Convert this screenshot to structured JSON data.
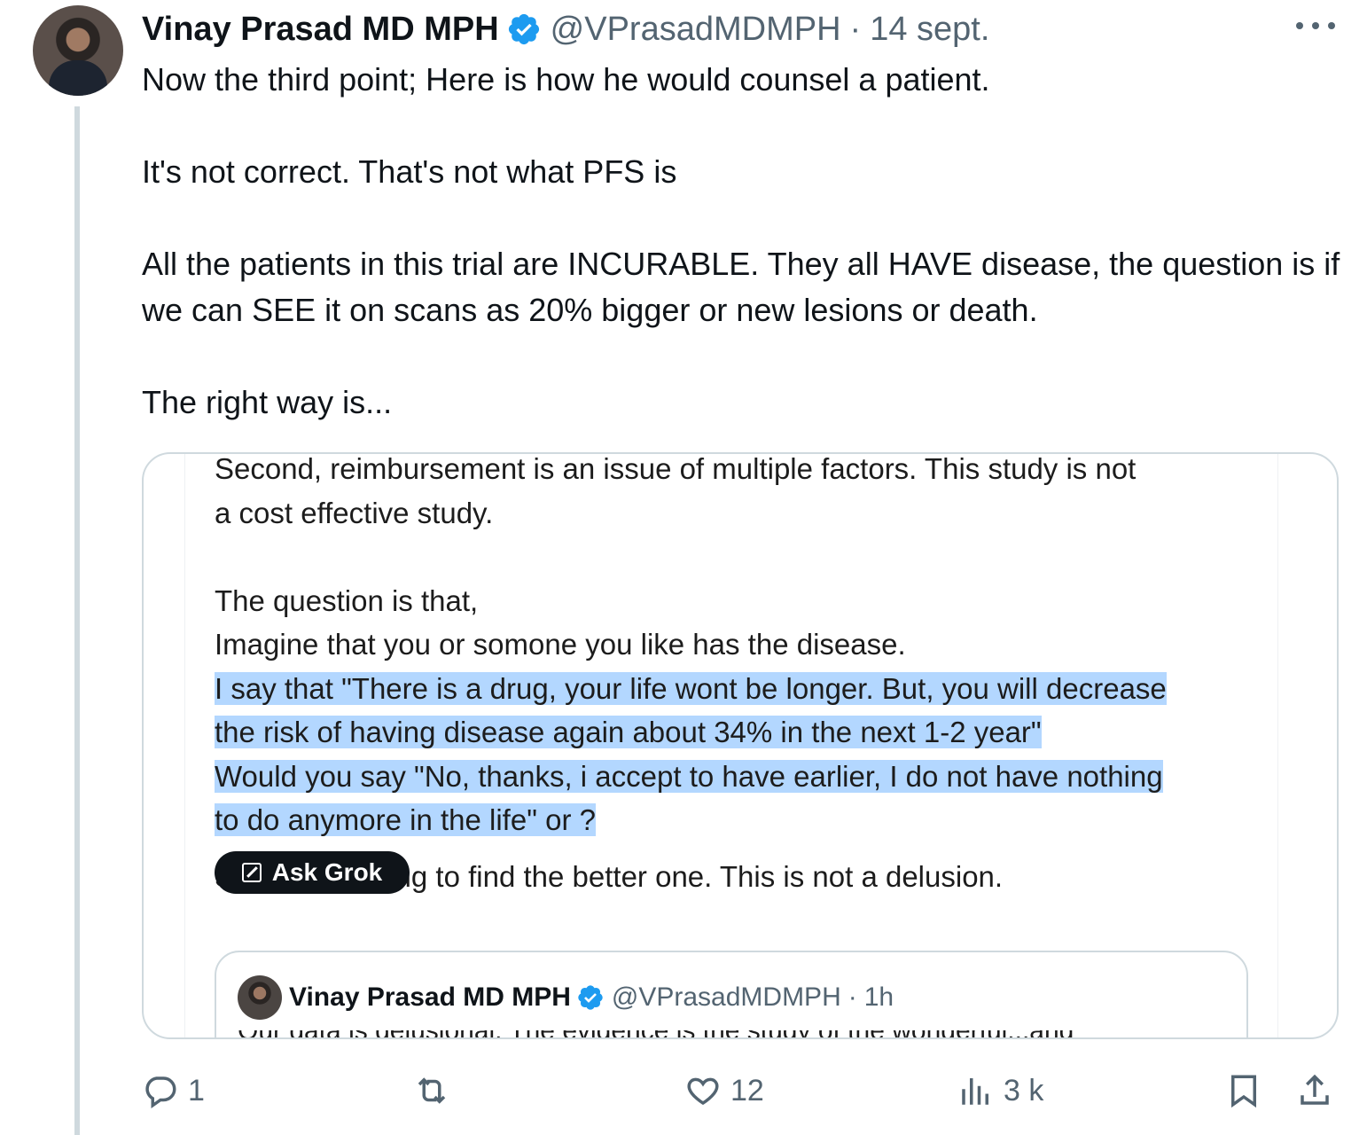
{
  "author": {
    "name": "Vinay Prasad MD MPH",
    "handle": "@VPrasadMDMPH",
    "separator": "·",
    "date": "14 sept."
  },
  "tweet": {
    "paragraphs": [
      "Now the third point; Here is how he would counsel a patient.",
      "It's not correct. That's not what PFS is",
      "All the patients in this trial are INCURABLE.  They all HAVE disease, the question is if we can SEE it on scans as 20% bigger or new lesions or death.",
      "The right way is..."
    ]
  },
  "embedded_screenshot": {
    "lines": [
      "Second, reimbursement is an issue of multiple factors. This study is not",
      "a cost effective study.",
      "",
      "The question is that,",
      "Imagine that you or somone you like has the disease."
    ],
    "highlighted_lines": [
      "I say that \"There is a drug, your life wont be longer. But, you will decrease",
      "the risk of having disease again about 34% in the next 1-2 year\"",
      "Would you say \"No, thanks, i accept to have earlier, I do not have nothing",
      "to do anymore in the life\" or ?"
    ],
    "ask_grok_label": "Ask Grok",
    "after_line": "Science is trying to find the better one. This is not a delusion.",
    "quote": {
      "name": "Vinay Prasad MD MPH",
      "handle": "@VPrasadMDMPH",
      "separator": "·",
      "time": "1h",
      "cut_text": "Our data is delusional. The evidence is the study of the wonderful...and"
    }
  },
  "actions": {
    "replies": "1",
    "reposts": "",
    "likes": "12",
    "views": "3 k"
  },
  "colors": {
    "verified": "#1d9bf0",
    "highlight": "#b3d7ff",
    "muted": "#536471"
  }
}
